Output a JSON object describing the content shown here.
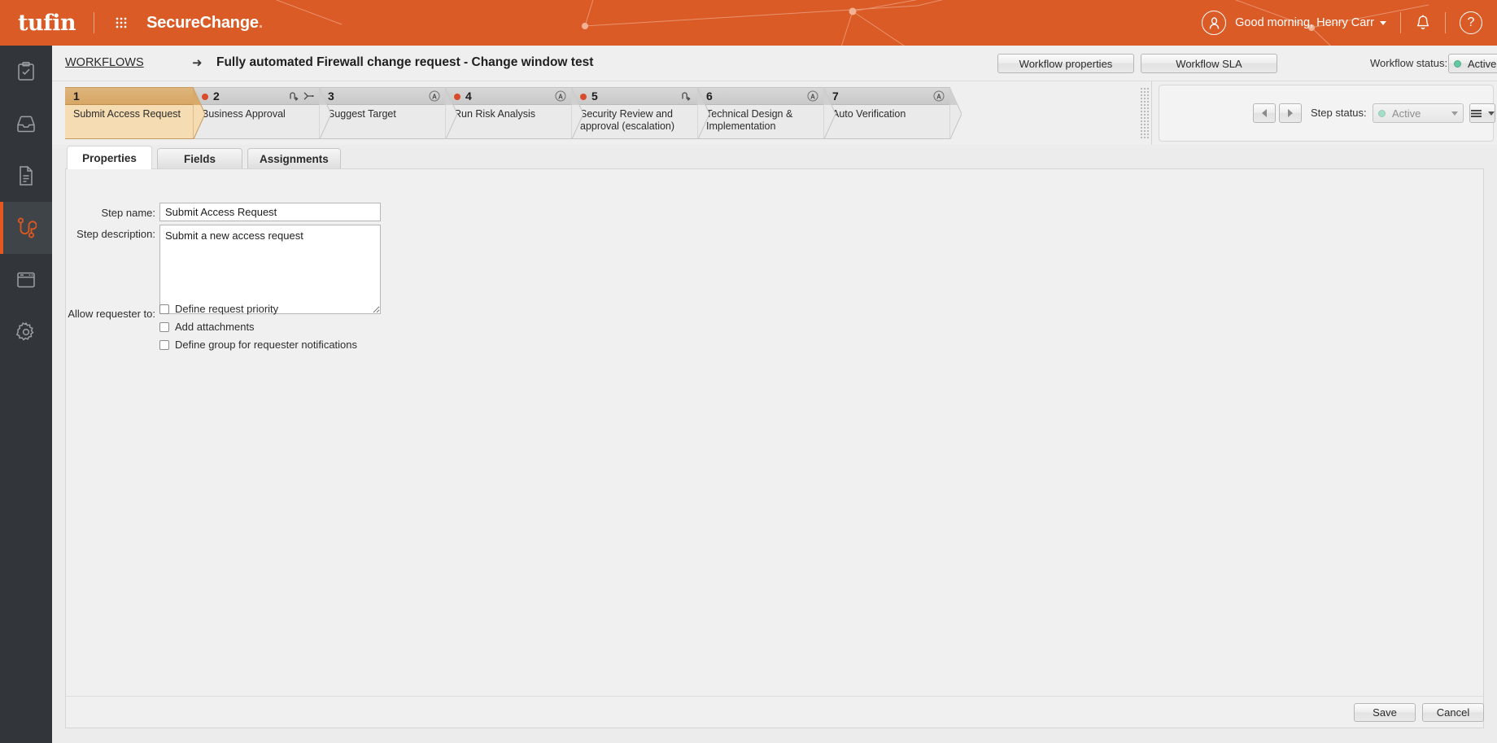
{
  "header": {
    "logo": "tufin",
    "product_name": "SecureChange",
    "product_dot": ".",
    "grid_icon": "app-grid-icon",
    "greeting": "Good morning, Henry Carr",
    "avatar_icon": "user-avatar-icon",
    "bell_icon": "notifications-bell-icon",
    "help_label": "?",
    "accent_color": "#da5b26"
  },
  "sidebar": {
    "items": [
      {
        "name": "tasks",
        "icon": "clipboard-check-icon",
        "active": false
      },
      {
        "name": "requests",
        "icon": "inbox-tray-icon",
        "active": false
      },
      {
        "name": "reports",
        "icon": "document-lines-icon",
        "active": false
      },
      {
        "name": "workflows",
        "icon": "workflow-path-icon",
        "active": true
      },
      {
        "name": "designer",
        "icon": "browser-window-icon",
        "active": false
      },
      {
        "name": "settings",
        "icon": "gear-icon",
        "active": false
      }
    ],
    "active_color": "#e2581f"
  },
  "page": {
    "breadcrumb": "WORKFLOWS",
    "breadcrumb_arrow": "➜",
    "title": "Fully automated Firewall change request - Change window test",
    "workflow_properties_label": "Workflow properties",
    "workflow_sla_label": "Workflow SLA",
    "workflow_status_label": "Workflow status:",
    "workflow_status_value": "Active",
    "workflow_status_color": "#64c8a0"
  },
  "steps": [
    {
      "num": "1",
      "label": "Submit Access Request",
      "current": true,
      "red_dot": false,
      "icons": []
    },
    {
      "num": "2",
      "label": "Business Approval",
      "current": false,
      "red_dot": true,
      "icons": [
        "reject-loop-icon",
        "branch-split-icon"
      ]
    },
    {
      "num": "3",
      "label": "Suggest Target",
      "current": false,
      "red_dot": false,
      "icons": [
        "auto-circle-a-icon"
      ]
    },
    {
      "num": "4",
      "label": "Run Risk Analysis",
      "current": false,
      "red_dot": true,
      "icons": [
        "auto-circle-a-icon"
      ]
    },
    {
      "num": "5",
      "label": "Security Review and approval (escalation)",
      "current": false,
      "red_dot": true,
      "icons": [
        "reject-loop-icon"
      ]
    },
    {
      "num": "6",
      "label": "Technical Design & Implementation",
      "current": false,
      "red_dot": false,
      "icons": [
        "auto-circle-a-icon"
      ]
    },
    {
      "num": "7",
      "label": "Auto Verification",
      "current": false,
      "red_dot": false,
      "icons": [
        "auto-circle-a-icon"
      ]
    }
  ],
  "step_controls": {
    "prev_icon": "arrow-left-icon",
    "next_icon": "arrow-right-icon",
    "step_status_label": "Step status:",
    "step_status_value": "Active",
    "menu_icon": "hamburger-menu-icon",
    "delete_icon": "trash-can-icon"
  },
  "tabs": [
    {
      "label": "Properties",
      "active": true
    },
    {
      "label": "Fields",
      "active": false
    },
    {
      "label": "Assignments",
      "active": false
    }
  ],
  "form": {
    "step_name_label": "Step name:",
    "step_name_value": "Submit Access Request",
    "step_name_placeholder": "",
    "step_description_label": "Step description:",
    "step_description_value": "Submit a new access request",
    "step_description_placeholder": "",
    "allow_label": "Allow requester to:",
    "checkboxes": [
      {
        "label": "Define request priority",
        "checked": false
      },
      {
        "label": "Add attachments",
        "checked": false
      },
      {
        "label": "Define group for requester notifications",
        "checked": false
      }
    ]
  },
  "footer": {
    "save_label": "Save",
    "cancel_label": "Cancel"
  }
}
